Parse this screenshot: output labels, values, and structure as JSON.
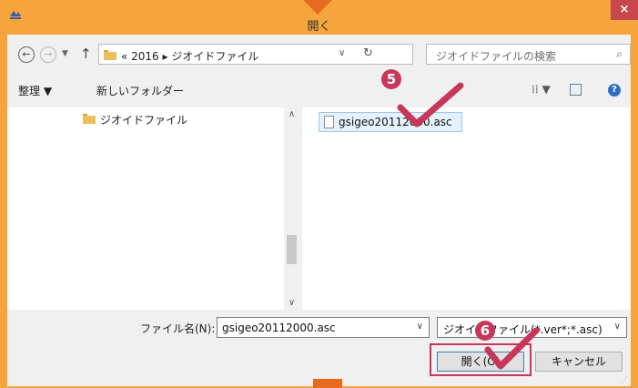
{
  "window": {
    "title": "開く",
    "close_label": "×"
  },
  "nav": {
    "back": "←",
    "forward": "→",
    "history": "▼",
    "up": "↑",
    "path": "« 2016 ▸ ジオイドファイル",
    "path_dropdown": "∨",
    "refresh": "↻"
  },
  "search": {
    "placeholder": "ジオイドファイルの検索",
    "icon": "⌕"
  },
  "toolbar": {
    "organize": "整理 ▼",
    "new_folder": "新しいフォルダー",
    "view": "⁞⁞ ▼",
    "help": "?"
  },
  "tree": {
    "items": [
      {
        "label": "ジオイドファイル"
      }
    ]
  },
  "scroll": {
    "up": "∧",
    "down": "∨"
  },
  "files": [
    {
      "name": "gsigeo20112000.asc"
    }
  ],
  "filename": {
    "label": "ファイル名(N):",
    "value": "gsigeo20112000.asc",
    "dropdown": "∨"
  },
  "filetype": {
    "value": "ジオイドファイル(*.ver*;*.asc)",
    "dropdown": "∨"
  },
  "buttons": {
    "open": "開く(O)",
    "cancel": "キャンセル"
  },
  "steps": {
    "step5": "5",
    "step6": "6"
  },
  "colors": {
    "frame": "#f5a53b",
    "accent": "#c8375a",
    "close": "#c7474a",
    "marker": "#e76b1f"
  }
}
